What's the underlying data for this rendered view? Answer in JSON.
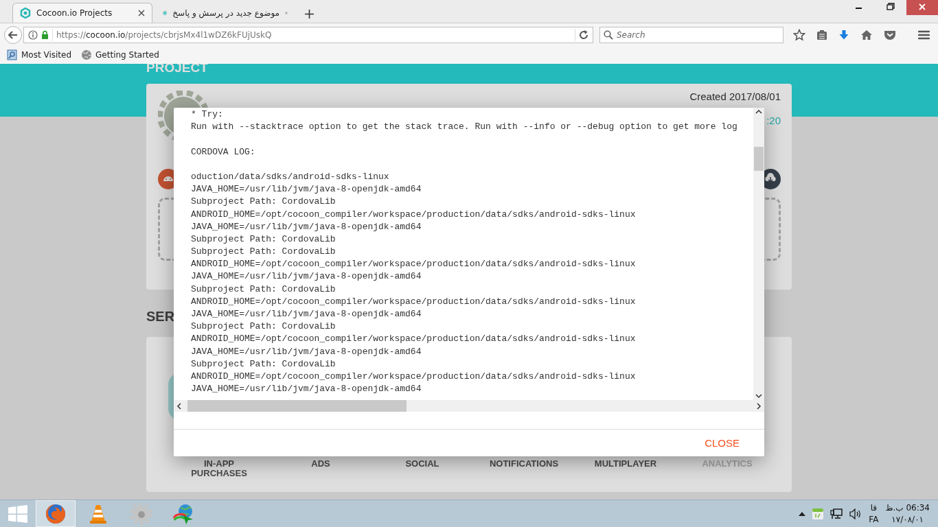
{
  "browser": {
    "tabs": [
      {
        "title": "Cocoon.io Projects",
        "selected": true
      },
      {
        "title": "موضوع جدید در پرسش و پاسخ",
        "selected": false
      }
    ],
    "address": {
      "scheme": "https://",
      "host": "cocoon.io",
      "path": "/projects/cbrjsMx4l1wDZ6kFUjUskQ"
    },
    "search": {
      "placeholder": "Search"
    },
    "bookmarks": [
      "Most Visited",
      "Getting Started"
    ]
  },
  "page": {
    "header_title": "PROJECT",
    "created": "Created 2017/08/01",
    "time_fragment": ":20",
    "section_title": "SER",
    "services": [
      {
        "label": "IN-APP PURCHASES",
        "disabled": false
      },
      {
        "label": "ADS",
        "disabled": false
      },
      {
        "label": "SOCIAL",
        "disabled": false
      },
      {
        "label": "NOTIFICATIONS",
        "disabled": false
      },
      {
        "label": "MULTIPLAYER",
        "disabled": false
      },
      {
        "label": "ANALYTICS",
        "disabled": true
      }
    ]
  },
  "dialog": {
    "log_blocks": [
      [
        "* Try:",
        "Run with --stacktrace option to get the stack trace. Run with --info or --debug option to get more log"
      ],
      [
        "CORDOVA LOG:"
      ],
      [
        "oduction/data/sdks/android-sdks-linux",
        "JAVA_HOME=/usr/lib/jvm/java-8-openjdk-amd64",
        "Subproject Path: CordovaLib",
        "ANDROID_HOME=/opt/cocoon_compiler/workspace/production/data/sdks/android-sdks-linux",
        "JAVA_HOME=/usr/lib/jvm/java-8-openjdk-amd64",
        "Subproject Path: CordovaLib",
        "Subproject Path: CordovaLib",
        "ANDROID_HOME=/opt/cocoon_compiler/workspace/production/data/sdks/android-sdks-linux",
        "JAVA_HOME=/usr/lib/jvm/java-8-openjdk-amd64",
        "Subproject Path: CordovaLib",
        "ANDROID_HOME=/opt/cocoon_compiler/workspace/production/data/sdks/android-sdks-linux",
        "JAVA_HOME=/usr/lib/jvm/java-8-openjdk-amd64",
        "Subproject Path: CordovaLib",
        "ANDROID_HOME=/opt/cocoon_compiler/workspace/production/data/sdks/android-sdks-linux",
        "JAVA_HOME=/usr/lib/jvm/java-8-openjdk-amd64",
        "Subproject Path: CordovaLib",
        "ANDROID_HOME=/opt/cocoon_compiler/workspace/production/data/sdks/android-sdks-linux",
        "JAVA_HOME=/usr/lib/jvm/java-8-openjdk-amd64"
      ]
    ],
    "close_label": "CLOSE"
  },
  "taskbar": {
    "apps": [
      {
        "kind": "firefox",
        "active": true
      },
      {
        "kind": "vlc",
        "active": false
      },
      {
        "kind": "gear",
        "active": false
      },
      {
        "kind": "downloader",
        "active": false
      }
    ],
    "language": "فا",
    "language_code": "FA",
    "time": "06:34 ب.ظ",
    "date": "۱۷/۰۸/۰۱"
  }
}
